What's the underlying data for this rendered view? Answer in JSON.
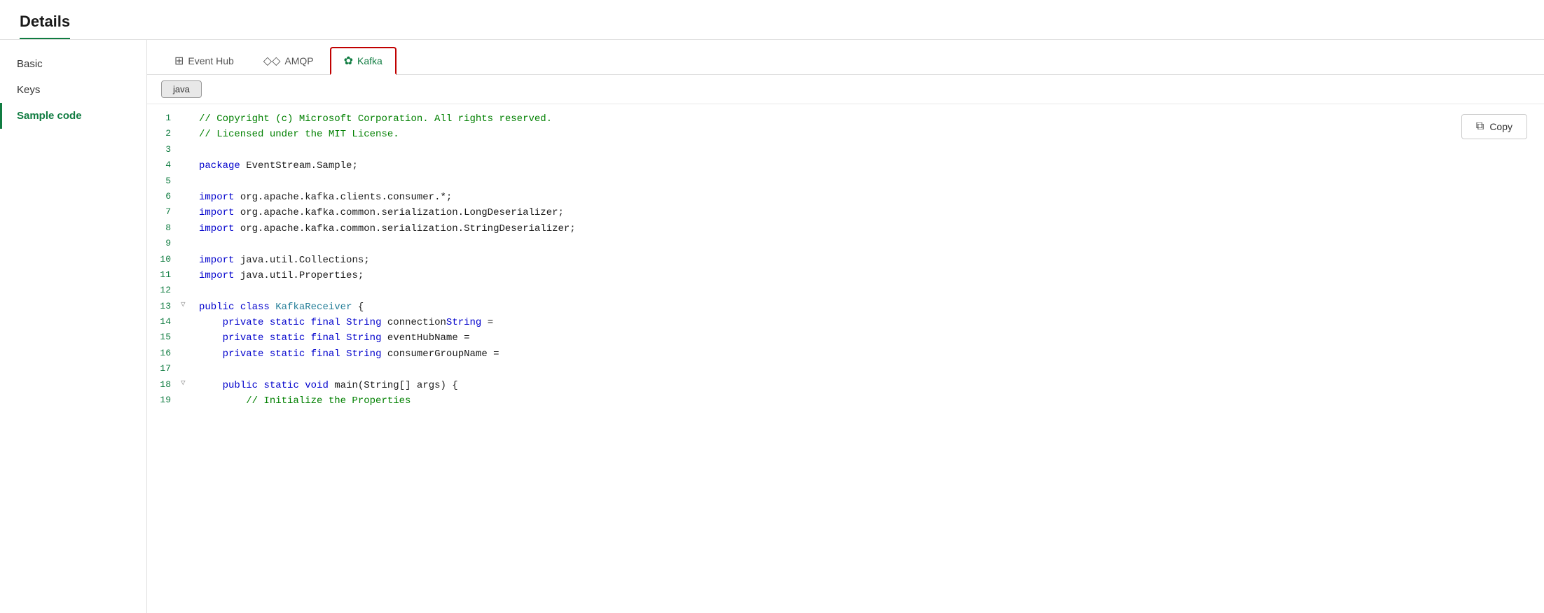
{
  "title": "Details",
  "sidebar": {
    "items": [
      {
        "id": "basic",
        "label": "Basic",
        "active": false
      },
      {
        "id": "keys",
        "label": "Keys",
        "active": false
      },
      {
        "id": "sample-code",
        "label": "Sample code",
        "active": true
      }
    ]
  },
  "tabs": [
    {
      "id": "event-hub",
      "label": "Event Hub",
      "icon": "⊞",
      "active": false
    },
    {
      "id": "amqp",
      "label": "AMQP",
      "icon": "◇◇",
      "active": false
    },
    {
      "id": "kafka",
      "label": "Kafka",
      "icon": "✿",
      "active": true
    }
  ],
  "language": {
    "options": [
      "java"
    ],
    "selected": "java"
  },
  "copy_button": {
    "label": "Copy",
    "icon": "copy"
  },
  "code": {
    "lines": [
      {
        "num": 1,
        "fold": "",
        "content": "// Copyright (c) Microsoft Corporation. All rights reserved.",
        "type": "comment"
      },
      {
        "num": 2,
        "fold": "",
        "content": "// Licensed under the MIT License.",
        "type": "comment"
      },
      {
        "num": 3,
        "fold": "",
        "content": "",
        "type": "blank"
      },
      {
        "num": 4,
        "fold": "",
        "content": "package EventStream.Sample;",
        "type": "code"
      },
      {
        "num": 5,
        "fold": "",
        "content": "",
        "type": "blank"
      },
      {
        "num": 6,
        "fold": "",
        "content": "import org.apache.kafka.clients.consumer.*;",
        "type": "code"
      },
      {
        "num": 7,
        "fold": "",
        "content": "import org.apache.kafka.common.serialization.LongDeserializer;",
        "type": "code"
      },
      {
        "num": 8,
        "fold": "",
        "content": "import org.apache.kafka.common.serialization.StringDeserializer;",
        "type": "code"
      },
      {
        "num": 9,
        "fold": "",
        "content": "",
        "type": "blank"
      },
      {
        "num": 10,
        "fold": "",
        "content": "import java.util.Collections;",
        "type": "code"
      },
      {
        "num": 11,
        "fold": "",
        "content": "import java.util.Properties;",
        "type": "code"
      },
      {
        "num": 12,
        "fold": "",
        "content": "",
        "type": "blank"
      },
      {
        "num": 13,
        "fold": "▽",
        "content": "public class KafkaReceiver {",
        "type": "class"
      },
      {
        "num": 14,
        "fold": "",
        "content": "    private static final String connectionString =",
        "type": "code"
      },
      {
        "num": 15,
        "fold": "",
        "content": "    private static final String eventHubName =",
        "type": "code"
      },
      {
        "num": 16,
        "fold": "",
        "content": "    private static final String consumerGroupName =",
        "type": "code"
      },
      {
        "num": 17,
        "fold": "",
        "content": "",
        "type": "blank"
      },
      {
        "num": 18,
        "fold": "▽",
        "content": "    public static void main(String[] args) {",
        "type": "method"
      },
      {
        "num": 19,
        "fold": "",
        "content": "        // Initialize the Properties",
        "type": "comment-indent"
      }
    ]
  }
}
